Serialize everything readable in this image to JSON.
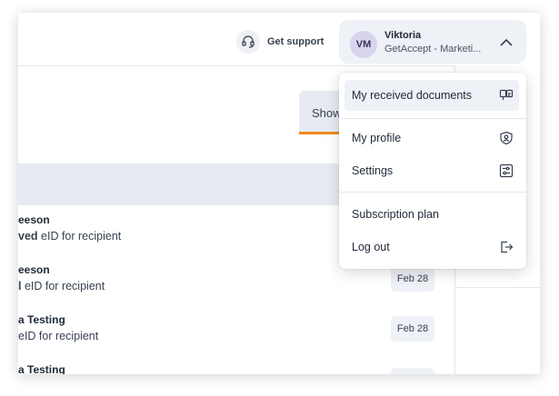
{
  "header": {
    "support_label": "Get support",
    "user": {
      "initials": "VM",
      "name": "Viktoria",
      "org": "GetAccept - Marketi..."
    }
  },
  "tabs": {
    "show_label": "Show"
  },
  "rows": [
    {
      "title": "eeson",
      "sub_bold": "ved",
      "sub_rest": " eID for recipient",
      "date": ""
    },
    {
      "title": "eeson",
      "sub_bold": "l",
      "sub_rest": " eID for recipient",
      "date": "Feb 28"
    },
    {
      "title": "a Testing",
      "sub_bold": "",
      "sub_rest": " eID for recipient",
      "date": "Feb 28"
    },
    {
      "title": "a Testing",
      "sub_bold": "",
      "sub_rest": "",
      "date": ""
    }
  ],
  "menu": {
    "received": "My received documents",
    "profile": "My profile",
    "settings": "Settings",
    "subscription": "Subscription plan",
    "logout": "Log out"
  },
  "colors": {
    "accent_orange": "#f08a1c",
    "surface_gray": "#eef1f6",
    "avatar_bg": "#d9d4ee"
  },
  "icons": {
    "support": "headset-icon",
    "chevron": "chevron-up-icon",
    "received": "inbox-documents-icon",
    "profile": "user-shield-icon",
    "settings": "sliders-icon",
    "logout": "logout-icon"
  }
}
